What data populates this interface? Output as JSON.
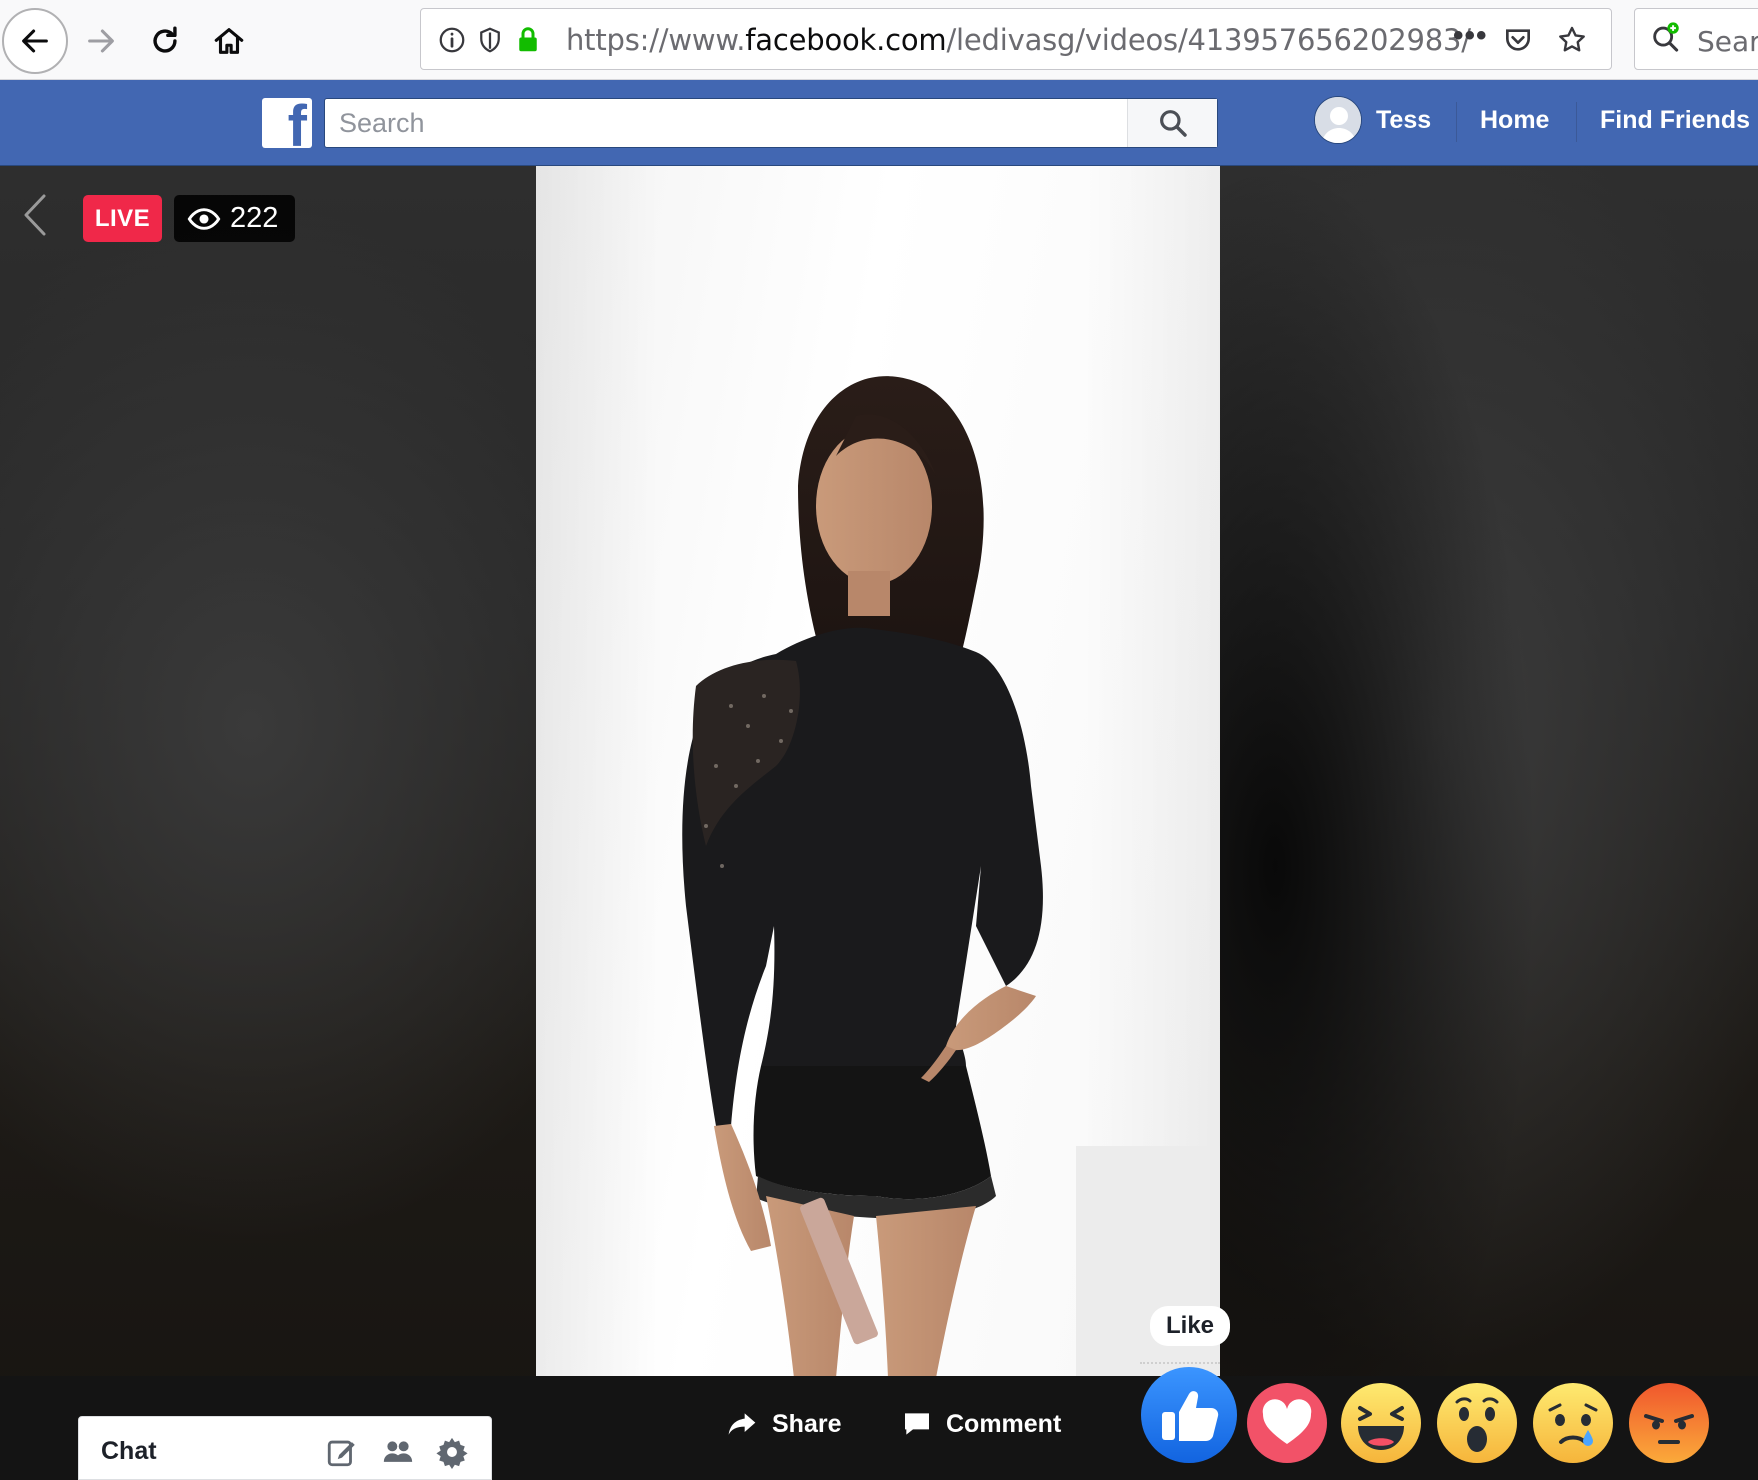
{
  "browser": {
    "url_prefix": "https://www.",
    "url_domain": "facebook.com",
    "url_path": "/ledivasg/videos/413957656202983/",
    "more_glyph": "•••",
    "search_placeholder": "Searc"
  },
  "header": {
    "logo_letter": "f",
    "search_placeholder": "Search",
    "user_name": "Tess",
    "nav_home": "Home",
    "nav_find_friends": "Find Friends",
    "brand_color": "#4267b2"
  },
  "video": {
    "live_label": "LIVE",
    "viewer_count": "222",
    "live_color": "#f02849"
  },
  "actions": {
    "share_label": "Share",
    "comment_label": "Comment",
    "like_tooltip": "Like"
  },
  "reactions": [
    {
      "name": "like",
      "icon": "like-icon"
    },
    {
      "name": "love",
      "icon": "love-icon"
    },
    {
      "name": "haha",
      "icon": "haha-icon"
    },
    {
      "name": "wow",
      "icon": "wow-icon"
    },
    {
      "name": "sad",
      "icon": "sad-icon"
    },
    {
      "name": "angry",
      "icon": "angry-icon"
    }
  ],
  "chat": {
    "label": "Chat",
    "icons": [
      "compose-icon",
      "contacts-icon",
      "settings-gear-icon"
    ]
  }
}
